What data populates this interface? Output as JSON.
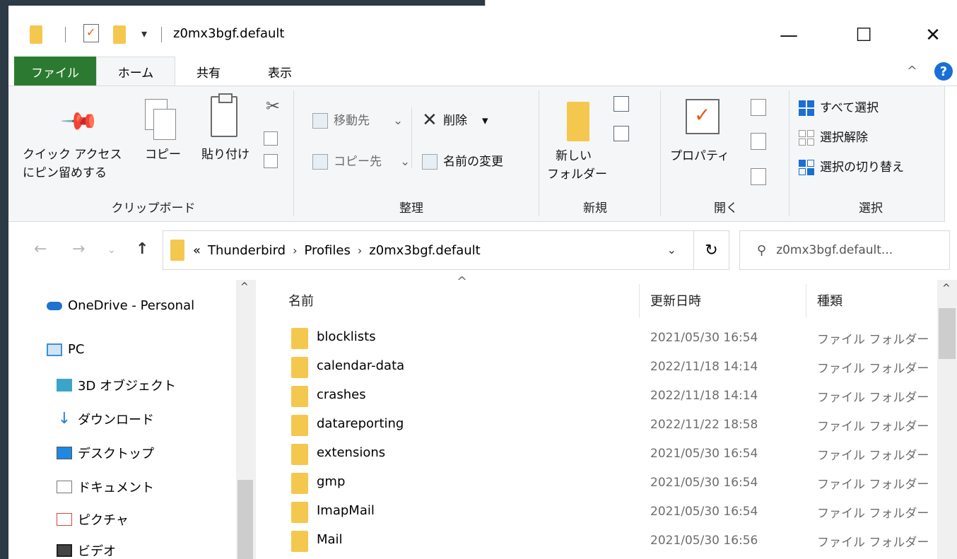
{
  "titlebar": {
    "title": "z0mx3bgf.default",
    "quick_access_dropdown": "▾",
    "minimize": "—",
    "maximize": "☐",
    "close": "✕"
  },
  "tabs": {
    "file": "ファイル",
    "home": "ホーム",
    "share": "共有",
    "view": "表示",
    "collapse": "^",
    "help": "?"
  },
  "ribbon": {
    "clipboard": {
      "label": "クリップボード",
      "pin_line1": "クイック アクセス",
      "pin_line2": "にピン留めする",
      "copy": "コピー",
      "paste": "貼り付け"
    },
    "organize": {
      "label": "整理",
      "move_to": "移動先",
      "copy_to": "コピー先",
      "delete": "削除",
      "rename": "名前の変更"
    },
    "new": {
      "label": "新規",
      "new_folder_line1": "新しい",
      "new_folder_line2": "フォルダー"
    },
    "open": {
      "label": "開く",
      "properties": "プロパティ"
    },
    "select": {
      "label": "選択",
      "select_all": "すべて選択",
      "select_none": "選択解除",
      "invert": "選択の切り替え"
    }
  },
  "address": {
    "overflow": "«",
    "crumbs": [
      "Thunderbird",
      "Profiles",
      "z0mx3bgf.default"
    ],
    "separator": "›",
    "dropdown": "⌄",
    "refresh": "↻",
    "search_placeholder": "z0mx3bgf.default..."
  },
  "navpane": {
    "items": [
      {
        "label": "OneDrive - Personal",
        "icon": "onedrive-icon",
        "color": "#1e72d2"
      },
      {
        "label": "PC",
        "icon": "pc-icon",
        "color": "#3d8fd6"
      },
      {
        "label": "3D オブジェクト",
        "icon": "3d-objects-icon",
        "color": "#3aa5c9"
      },
      {
        "label": "ダウンロード",
        "icon": "download-icon",
        "color": "#2a7bd6"
      },
      {
        "label": "デスクトップ",
        "icon": "desktop-icon",
        "color": "#1e88e5"
      },
      {
        "label": "ドキュメント",
        "icon": "documents-icon",
        "color": "#d04a3a"
      },
      {
        "label": "ピクチャ",
        "icon": "pictures-icon",
        "color": "#d04a3a"
      },
      {
        "label": "ビデオ",
        "icon": "videos-icon",
        "color": "#444444"
      }
    ]
  },
  "list": {
    "columns": {
      "name": "名前",
      "modified": "更新日時",
      "type": "種類"
    },
    "sort_indicator": "^",
    "rows": [
      {
        "name": "blocklists",
        "modified": "2021/05/30 16:54",
        "type": "ファイル フォルダー"
      },
      {
        "name": "calendar-data",
        "modified": "2022/11/18 14:14",
        "type": "ファイル フォルダー"
      },
      {
        "name": "crashes",
        "modified": "2022/11/18 14:14",
        "type": "ファイル フォルダー"
      },
      {
        "name": "datareporting",
        "modified": "2022/11/22 18:58",
        "type": "ファイル フォルダー"
      },
      {
        "name": "extensions",
        "modified": "2021/05/30 16:54",
        "type": "ファイル フォルダー"
      },
      {
        "name": "gmp",
        "modified": "2021/05/30 16:54",
        "type": "ファイル フォルダー"
      },
      {
        "name": "ImapMail",
        "modified": "2021/05/30 16:54",
        "type": "ファイル フォルダー"
      },
      {
        "name": "Mail",
        "modified": "2021/05/30 16:56",
        "type": "ファイル フォルダー"
      }
    ]
  },
  "colors": {
    "file_tab": "#2c7a31",
    "folder": "#f4c84f",
    "accent": "#1a6fd4"
  }
}
